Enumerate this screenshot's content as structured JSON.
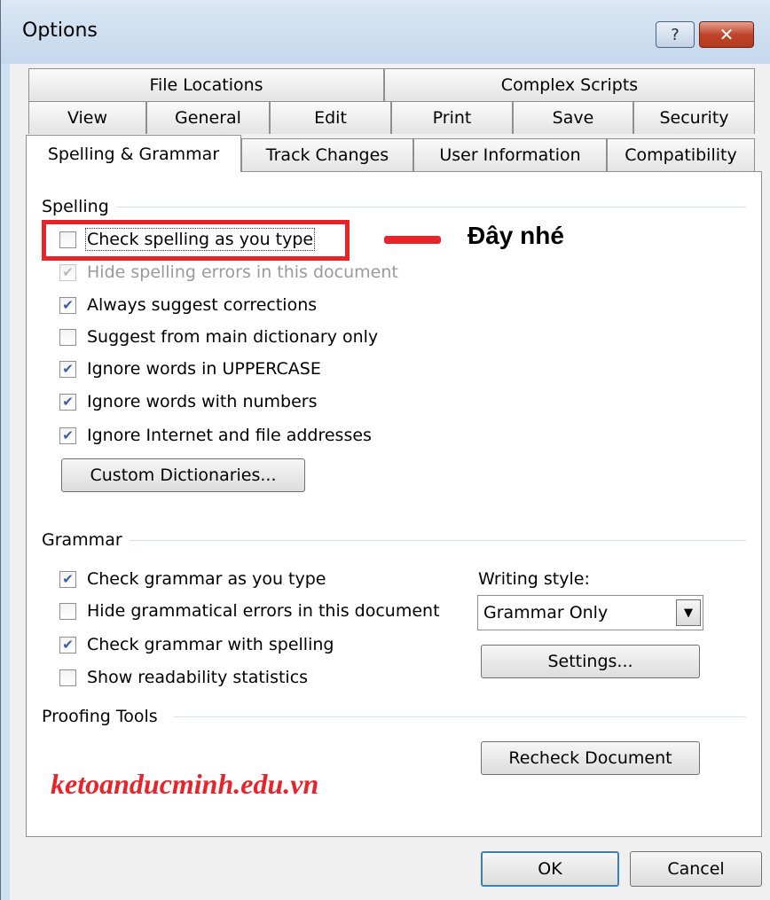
{
  "window": {
    "title": "Options",
    "help_glyph": "?",
    "close_glyph": "✕"
  },
  "tabs": {
    "row1": [
      "File Locations",
      "Complex Scripts"
    ],
    "row2": [
      "View",
      "General",
      "Edit",
      "Print",
      "Save",
      "Security"
    ],
    "row3": [
      "Spelling & Grammar",
      "Track Changes",
      "User Information",
      "Compatibility"
    ],
    "active": "Spelling & Grammar"
  },
  "spelling": {
    "label": "Spelling",
    "options": [
      {
        "label": "Check spelling as you type",
        "checked": false,
        "enabled": true
      },
      {
        "label": "Hide spelling errors in this document",
        "checked": true,
        "enabled": false
      },
      {
        "label": "Always suggest corrections",
        "checked": true,
        "enabled": true
      },
      {
        "label": "Suggest from main dictionary only",
        "checked": false,
        "enabled": true
      },
      {
        "label": "Ignore words in UPPERCASE",
        "checked": true,
        "enabled": true
      },
      {
        "label": "Ignore words with numbers",
        "checked": true,
        "enabled": true
      },
      {
        "label": "Ignore Internet and file addresses",
        "checked": true,
        "enabled": true
      }
    ],
    "custom_dict_button": "Custom Dictionaries..."
  },
  "grammar": {
    "label": "Grammar",
    "options": [
      {
        "label": "Check grammar as you type",
        "checked": true
      },
      {
        "label": "Hide grammatical errors in this document",
        "checked": false
      },
      {
        "label": "Check grammar with spelling",
        "checked": true
      },
      {
        "label": "Show readability statistics",
        "checked": false
      }
    ],
    "writing_style_label": "Writing style:",
    "writing_style_value": "Grammar Only",
    "settings_button": "Settings..."
  },
  "proofing": {
    "label": "Proofing Tools",
    "recheck_button": "Recheck Document"
  },
  "footer": {
    "ok": "OK",
    "cancel": "Cancel"
  },
  "annotation": {
    "text": "Đây nhé",
    "color": "#e8232a"
  },
  "watermark": "ketoanducminh.edu.vn"
}
